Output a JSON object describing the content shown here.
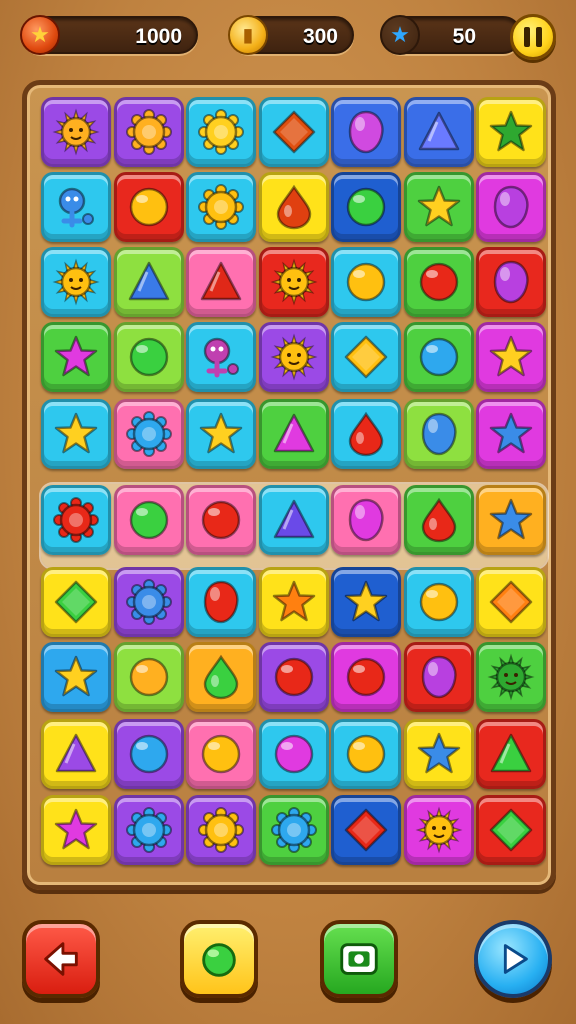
{
  "hud": {
    "score": "1000",
    "coins": "300",
    "moves": "50",
    "score_icon": "star-icon",
    "coins_icon": "coin-icon",
    "moves_icon": "star-icon",
    "pause_icon": "pause-icon"
  },
  "board": {
    "rows": 10,
    "cols": 7,
    "highlighted_row": 5,
    "tiles": [
      [
        [
          "#9b4ae6",
          "sun",
          "#ffb020"
        ],
        [
          "#9b4ae6",
          "gear",
          "#ffb020"
        ],
        [
          "#2ec8ee",
          "gear",
          "#ffd020"
        ],
        [
          "#2ec8ee",
          "diamond",
          "#e05010"
        ],
        [
          "#3a6ee8",
          "gem",
          "#d04ae0"
        ],
        [
          "#3a6ee8",
          "triangle",
          "#6a7aff"
        ],
        [
          "#ffe21a",
          "star",
          "#2ea830"
        ]
      ],
      [
        [
          "#2ec8ee",
          "creature",
          "#3a8ce8"
        ],
        [
          "#e8281e",
          "circle",
          "#ffc010"
        ],
        [
          "#2ec8ee",
          "gear",
          "#ffc010"
        ],
        [
          "#ffe21a",
          "drop",
          "#e04010"
        ],
        [
          "#1f5fd0",
          "circle",
          "#3ad040"
        ],
        [
          "#4ed040",
          "star",
          "#ffd020"
        ],
        [
          "#e03ae0",
          "gem",
          "#b840e0"
        ]
      ],
      [
        [
          "#2ec8ee",
          "sun",
          "#ffc010"
        ],
        [
          "#8ee040",
          "triangle",
          "#3a7ae8"
        ],
        [
          "#ff70b0",
          "triangle",
          "#e02818"
        ],
        [
          "#e8281e",
          "sun",
          "#ffc010"
        ],
        [
          "#2ec8ee",
          "circle",
          "#ffc010"
        ],
        [
          "#4ed040",
          "circle",
          "#e82818"
        ],
        [
          "#e8281e",
          "gem",
          "#b840e0"
        ]
      ],
      [
        [
          "#4ed040",
          "star",
          "#e03ae0"
        ],
        [
          "#8ee040",
          "circle",
          "#3ad040"
        ],
        [
          "#2ec8ee",
          "creature",
          "#c040b0"
        ],
        [
          "#9b4ae6",
          "sun",
          "#ffc010"
        ],
        [
          "#2ec8ee",
          "diamond",
          "#ffc010"
        ],
        [
          "#4ed040",
          "circle",
          "#2ea8ee"
        ],
        [
          "#e03ae0",
          "star",
          "#ffd020"
        ]
      ],
      [
        [
          "#2ec8ee",
          "star",
          "#ffd020"
        ],
        [
          "#ff70b0",
          "gear",
          "#2ea8ee"
        ],
        [
          "#2ec8ee",
          "star",
          "#ffd020"
        ],
        [
          "#4ed040",
          "triangle",
          "#e03ae0"
        ],
        [
          "#2ec8ee",
          "drop",
          "#e82818"
        ],
        [
          "#8ee040",
          "gem",
          "#3a8ce8"
        ],
        [
          "#e03ae0",
          "star",
          "#3a8ce8"
        ]
      ],
      [
        [
          "#2ec8ee",
          "gear",
          "#e82818"
        ],
        [
          "#ff70b0",
          "circle",
          "#3ad040"
        ],
        [
          "#ff70b0",
          "circle",
          "#e82818"
        ],
        [
          "#2ec8ee",
          "triangle",
          "#6a4ae8"
        ],
        [
          "#ff70b0",
          "gem",
          "#e03ae0"
        ],
        [
          "#4ed040",
          "drop",
          "#e82818"
        ],
        [
          "#ffb020",
          "star",
          "#3a8ce8"
        ]
      ],
      [
        [
          "#ffe21a",
          "diamond",
          "#3ad040"
        ],
        [
          "#9b4ae6",
          "gear",
          "#3a8ce8"
        ],
        [
          "#2ec8ee",
          "gem",
          "#e82818"
        ],
        [
          "#ffe21a",
          "star",
          "#ff8010"
        ],
        [
          "#1f5fd0",
          "star",
          "#ffd020"
        ],
        [
          "#2ec8ee",
          "circle",
          "#ffc010"
        ],
        [
          "#ffe21a",
          "diamond",
          "#ff8010"
        ]
      ],
      [
        [
          "#2ea8ee",
          "star",
          "#ffd020"
        ],
        [
          "#8ee040",
          "circle",
          "#ffb020"
        ],
        [
          "#ffb020",
          "drop",
          "#3ad040"
        ],
        [
          "#9b4ae6",
          "circle",
          "#e82818"
        ],
        [
          "#e03ae0",
          "circle",
          "#e82818"
        ],
        [
          "#e8281e",
          "gem",
          "#b840e0"
        ],
        [
          "#4ed040",
          "sun",
          "#2ea830"
        ]
      ],
      [
        [
          "#ffe21a",
          "triangle",
          "#9b4ae6"
        ],
        [
          "#9b4ae6",
          "circle",
          "#2ea8ee"
        ],
        [
          "#ff70b0",
          "circle",
          "#ffc010"
        ],
        [
          "#2ec8ee",
          "circle",
          "#e03ae0"
        ],
        [
          "#2ec8ee",
          "circle",
          "#ffc010"
        ],
        [
          "#ffe21a",
          "star",
          "#3a8ce8"
        ],
        [
          "#e8281e",
          "triangle",
          "#3ad040"
        ]
      ],
      [
        [
          "#ffe21a",
          "star",
          "#e03ae0"
        ],
        [
          "#9b4ae6",
          "gear",
          "#2ea8ee"
        ],
        [
          "#9b4ae6",
          "gear",
          "#ffc010"
        ],
        [
          "#4ed040",
          "gear",
          "#2ea8ee"
        ],
        [
          "#1f5fd0",
          "diamond",
          "#e82818"
        ],
        [
          "#e03ae0",
          "sun",
          "#ffc010"
        ],
        [
          "#e8281e",
          "diamond",
          "#3ad040"
        ]
      ]
    ]
  },
  "controls": {
    "back_icon": "back-arrow-icon",
    "hint_icon": "hint-gem-icon",
    "shot_icon": "camera-icon",
    "play_icon": "play-icon"
  }
}
